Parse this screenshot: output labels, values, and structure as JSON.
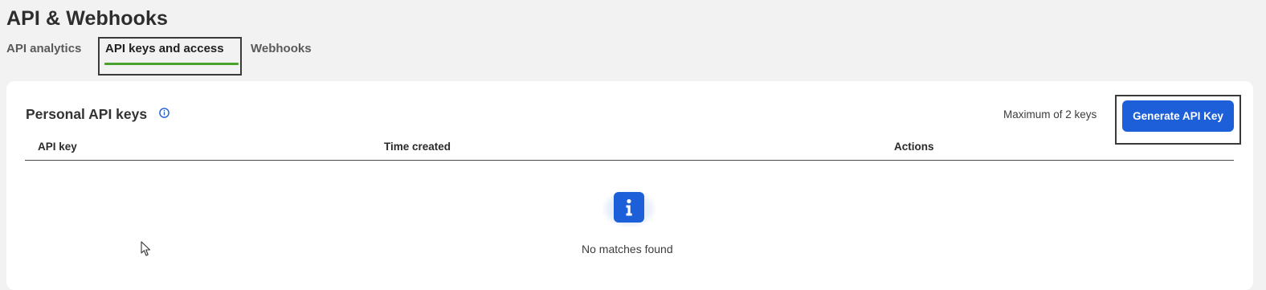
{
  "page": {
    "title": "API & Webhooks"
  },
  "tabs": [
    {
      "label": "API analytics",
      "active": false
    },
    {
      "label": "API keys and access",
      "active": true
    },
    {
      "label": "Webhooks",
      "active": false
    }
  ],
  "section": {
    "title": "Personal API keys",
    "info_icon": "info-circle-icon",
    "limit_text": "Maximum of 2 keys",
    "generate_button": "Generate API Key"
  },
  "table": {
    "columns": [
      "API key",
      "Time created",
      "Actions"
    ],
    "rows": [],
    "empty_icon": "info-square-icon",
    "empty_text": "No matches found"
  },
  "colors": {
    "accent_blue": "#1c5fd8",
    "active_tab_underline": "#4aa12c",
    "background": "#f2f2f2"
  }
}
